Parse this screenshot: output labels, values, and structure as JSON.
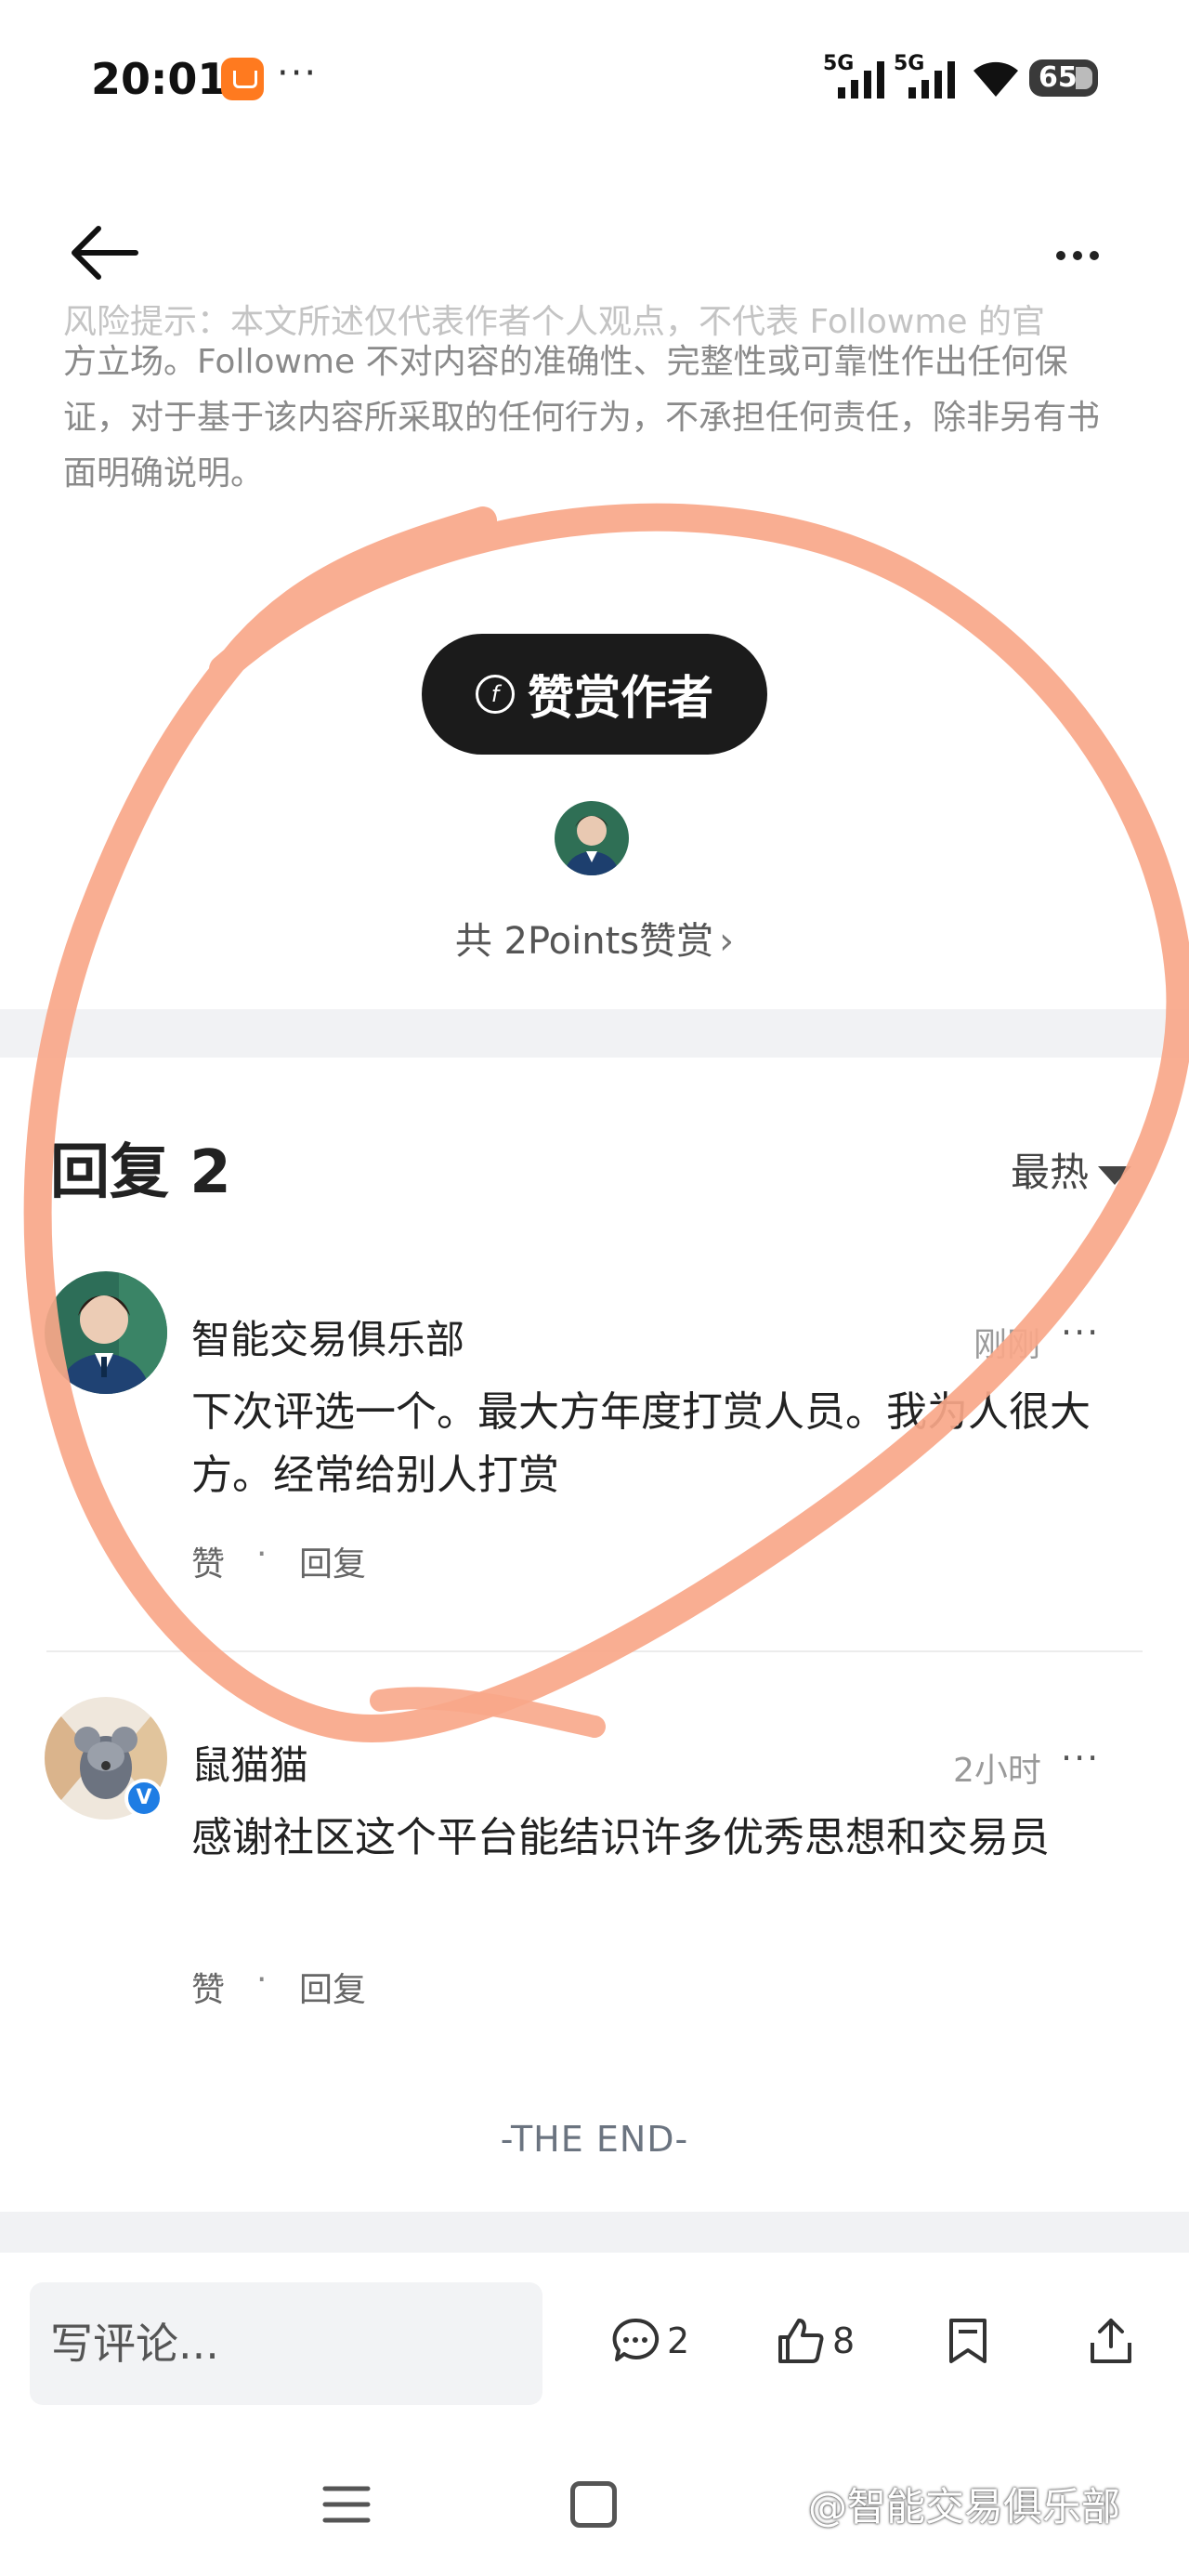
{
  "status_bar": {
    "time": "20:01",
    "more": "···",
    "signal_1": "5G",
    "signal_2": "5G",
    "battery": "65"
  },
  "header": {
    "back_icon": "arrow-left-icon",
    "more_icon": "more-horizontal-icon"
  },
  "disclaimer": {
    "faded_line": "风险提示：本文所述仅代表作者个人观点，不代表 Followme 的官",
    "text": "方立场。Followme 不对内容的准确性、完整性或可靠性作出任何保证，对于基于该内容所采取的任何行为，不承担任何责任，除非另有书面明确说明。"
  },
  "reward": {
    "button_label": "赞赏作者",
    "coin_symbol": "f",
    "count_text": "共 2Points赞赏",
    "chevron": "›"
  },
  "replies": {
    "title": "回复 2",
    "sort_label": "最热",
    "comments": [
      {
        "name": "智能交易俱乐部",
        "time": "刚刚",
        "more": "···",
        "text": "下次评选一个。最大方年度打赏人员。我为人很大方。经常给别人打赏",
        "like": "赞",
        "sep": "·",
        "reply": "回复"
      },
      {
        "name": "鼠猫猫",
        "time": "2小时",
        "more": "···",
        "text": "感谢社区这个平台能结识许多优秀思想和交易员",
        "like": "赞",
        "sep": "·",
        "reply": "回复",
        "verified": "V"
      }
    ]
  },
  "end_text": "-THE END-",
  "bottom_bar": {
    "comment_placeholder": "写评论...",
    "comment_count": "2",
    "like_count": "8"
  },
  "watermark": "@智能交易俱乐部",
  "colors": {
    "annotation": "#f8a789",
    "reward_button": "#1b1b1b",
    "verified": "#1e7de4"
  }
}
